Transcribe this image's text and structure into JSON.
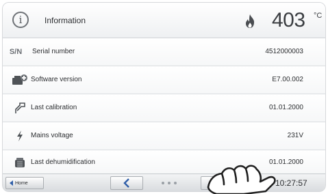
{
  "header": {
    "title": "Information",
    "info_icon_glyph": "i",
    "temperature": "403",
    "unit": "°C",
    "flame_color": "#444444"
  },
  "rows": [
    {
      "icon": "sn-icon",
      "icon_text": "S/N",
      "label": "Serial number",
      "value": "4512000003"
    },
    {
      "icon": "software-icon",
      "label": "Software version",
      "value": "E7.00.002"
    },
    {
      "icon": "calibration-icon",
      "label": "Last calibration",
      "value": "01.01.2000"
    },
    {
      "icon": "lightning-icon",
      "label": "Mains voltage",
      "value": "231V"
    },
    {
      "icon": "dehumidification-icon",
      "label": "Last dehumidification",
      "value": "01.01.2000"
    }
  ],
  "footer": {
    "home_label": "Home",
    "back_arrow": "<",
    "time": "10:27:57",
    "accent": "#2f5ea8"
  }
}
